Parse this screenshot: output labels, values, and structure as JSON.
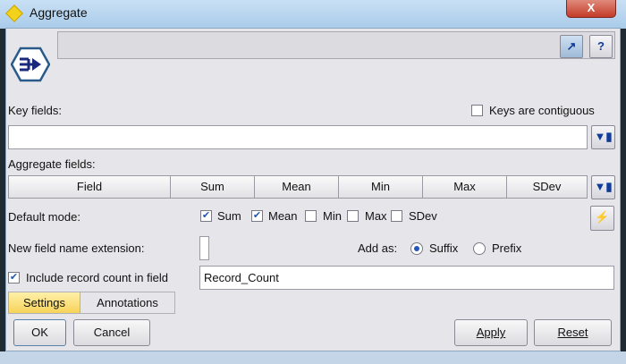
{
  "window": {
    "title": "Aggregate",
    "close_label": "X"
  },
  "header": {
    "node_icon": "aggregate-node-icon",
    "preview_icon": "arrow-up-right-icon",
    "help_icon": "question-icon",
    "help_label": "?"
  },
  "key_fields": {
    "label": "Key fields:",
    "contiguous_label": "Keys are contiguous",
    "contiguous_checked": false,
    "value": ""
  },
  "aggregate_fields": {
    "label": "Aggregate fields:",
    "columns": [
      "Field",
      "Sum",
      "Mean",
      "Min",
      "Max",
      "SDev"
    ],
    "rows": []
  },
  "default_mode": {
    "label": "Default mode:",
    "options": [
      {
        "label": "Sum",
        "checked": true
      },
      {
        "label": "Mean",
        "checked": true
      },
      {
        "label": "Min",
        "checked": false
      },
      {
        "label": "Max",
        "checked": false
      },
      {
        "label": "SDev",
        "checked": false
      }
    ]
  },
  "extension": {
    "label": "New field name extension:",
    "value": "",
    "add_as_label": "Add as:",
    "suffix_label": "Suffix",
    "prefix_label": "Prefix",
    "selected": "Suffix"
  },
  "record_count": {
    "label": "Include record count in field",
    "checked": true,
    "value": "Record_Count"
  },
  "tabs": [
    {
      "label": "Settings",
      "active": true
    },
    {
      "label": "Annotations",
      "active": false
    }
  ],
  "buttons": {
    "ok": "OK",
    "cancel": "Cancel",
    "apply": "Apply",
    "reset": "Reset"
  }
}
